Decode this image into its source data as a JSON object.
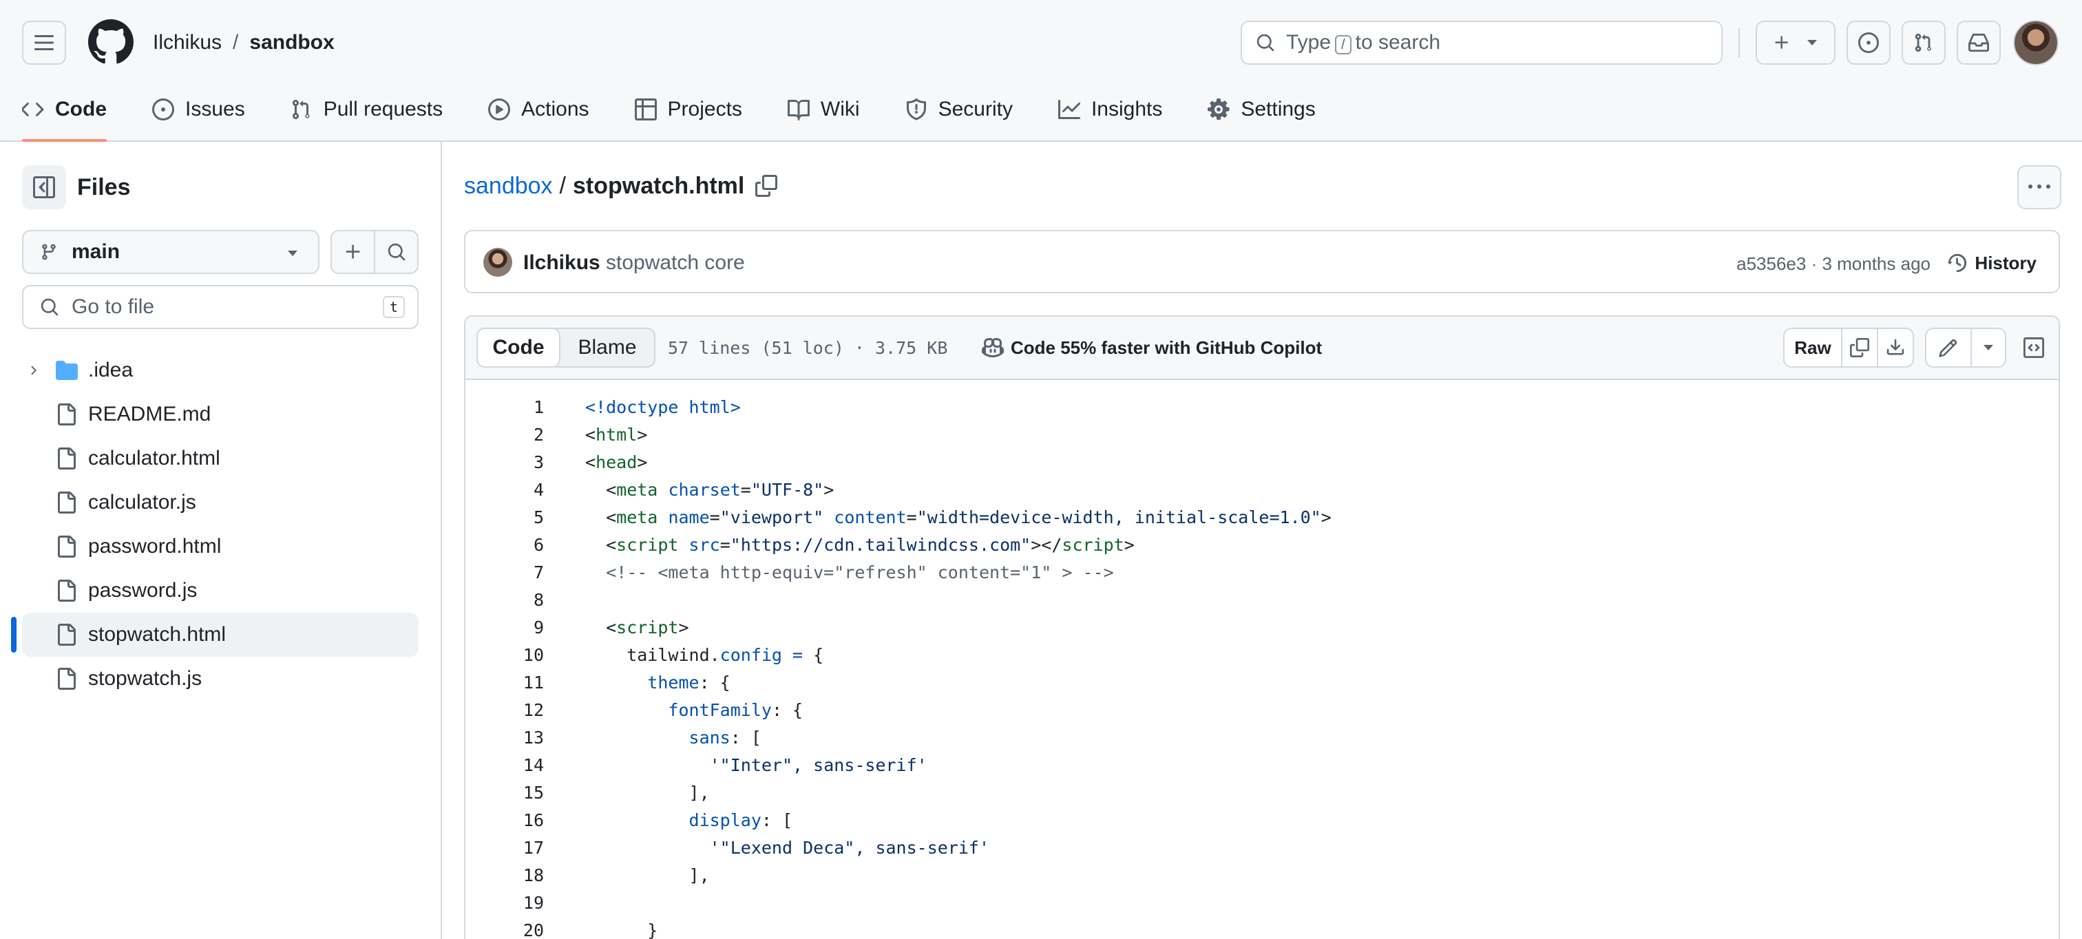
{
  "header": {
    "owner": "Ilchikus",
    "separator": "/",
    "repo": "sandbox",
    "search_prefix": "Type",
    "search_key": "/",
    "search_suffix": "to search"
  },
  "tabs": [
    {
      "label": "Code",
      "icon": "code-icon",
      "active": true
    },
    {
      "label": "Issues",
      "icon": "issue-opened-icon"
    },
    {
      "label": "Pull requests",
      "icon": "git-pull-request-icon"
    },
    {
      "label": "Actions",
      "icon": "play-icon"
    },
    {
      "label": "Projects",
      "icon": "table-icon"
    },
    {
      "label": "Wiki",
      "icon": "book-icon"
    },
    {
      "label": "Security",
      "icon": "shield-icon"
    },
    {
      "label": "Insights",
      "icon": "graph-icon"
    },
    {
      "label": "Settings",
      "icon": "gear-icon"
    }
  ],
  "sidebar": {
    "title": "Files",
    "branch": "main",
    "goto_placeholder": "Go to file",
    "goto_key": "t",
    "items": [
      {
        "label": ".idea",
        "type": "folder"
      },
      {
        "label": "README.md",
        "type": "file"
      },
      {
        "label": "calculator.html",
        "type": "file"
      },
      {
        "label": "calculator.js",
        "type": "file"
      },
      {
        "label": "password.html",
        "type": "file"
      },
      {
        "label": "password.js",
        "type": "file"
      },
      {
        "label": "stopwatch.html",
        "type": "file",
        "selected": true
      },
      {
        "label": "stopwatch.js",
        "type": "file"
      }
    ]
  },
  "file": {
    "repo_link": "sandbox",
    "separator": "/",
    "name": "stopwatch.html"
  },
  "commit": {
    "author": "Ilchikus",
    "message": "stopwatch core",
    "meta": "a5356e3 · 3 months ago",
    "history_label": "History"
  },
  "code_toolbar": {
    "code_tab": "Code",
    "blame_tab": "Blame",
    "stats": "57 lines (51 loc) · 3.75 KB",
    "copilot": "Code 55% faster with GitHub Copilot",
    "raw_label": "Raw"
  },
  "code": [
    {
      "n": "1",
      "t": [
        [
          "kw",
          "<!doctype html>"
        ]
      ]
    },
    {
      "n": "2",
      "t": [
        [
          "",
          "<"
        ],
        [
          "tag",
          "html"
        ],
        [
          "",
          ">"
        ]
      ]
    },
    {
      "n": "3",
      "t": [
        [
          "",
          "<"
        ],
        [
          "tag",
          "head"
        ],
        [
          "",
          ">"
        ]
      ]
    },
    {
      "n": "4",
      "t": [
        [
          "",
          "  <"
        ],
        [
          "tag",
          "meta"
        ],
        [
          "",
          " "
        ],
        [
          "kw",
          "charset"
        ],
        [
          "",
          "="
        ],
        [
          "str",
          "\"UTF-8\""
        ],
        [
          "",
          ">"
        ]
      ]
    },
    {
      "n": "5",
      "t": [
        [
          "",
          "  <"
        ],
        [
          "tag",
          "meta"
        ],
        [
          "",
          " "
        ],
        [
          "kw",
          "name"
        ],
        [
          "",
          "="
        ],
        [
          "str",
          "\"viewport\""
        ],
        [
          "",
          " "
        ],
        [
          "kw",
          "content"
        ],
        [
          "",
          "="
        ],
        [
          "str",
          "\"width=device-width, initial-scale=1.0\""
        ],
        [
          "",
          ">"
        ]
      ]
    },
    {
      "n": "6",
      "t": [
        [
          "",
          "  <"
        ],
        [
          "tag",
          "script"
        ],
        [
          "",
          " "
        ],
        [
          "kw",
          "src"
        ],
        [
          "",
          "="
        ],
        [
          "str",
          "\"https://cdn.tailwindcss.com\""
        ],
        [
          "",
          "></"
        ],
        [
          "tag",
          "script"
        ],
        [
          "",
          ">"
        ]
      ]
    },
    {
      "n": "7",
      "t": [
        [
          "cmt",
          "  <!-- <meta http-equiv=\"refresh\" content=\"1\" > -->"
        ]
      ]
    },
    {
      "n": "8",
      "t": [
        [
          "",
          ""
        ]
      ]
    },
    {
      "n": "9",
      "t": [
        [
          "",
          "  <"
        ],
        [
          "tag",
          "script"
        ],
        [
          "",
          ">"
        ]
      ]
    },
    {
      "n": "10",
      "t": [
        [
          "",
          "    tailwind."
        ],
        [
          "prop",
          "config"
        ],
        [
          "",
          " "
        ],
        [
          "kw",
          "="
        ],
        [
          "",
          " {"
        ]
      ]
    },
    {
      "n": "11",
      "t": [
        [
          "",
          "      "
        ],
        [
          "prop",
          "theme"
        ],
        [
          "",
          ": {"
        ]
      ]
    },
    {
      "n": "12",
      "t": [
        [
          "",
          "        "
        ],
        [
          "prop",
          "fontFamily"
        ],
        [
          "",
          ": {"
        ]
      ]
    },
    {
      "n": "13",
      "t": [
        [
          "",
          "          "
        ],
        [
          "prop",
          "sans"
        ],
        [
          "",
          ": ["
        ]
      ]
    },
    {
      "n": "14",
      "t": [
        [
          "",
          "            "
        ],
        [
          "str",
          "'\"Inter\", sans-serif'"
        ]
      ]
    },
    {
      "n": "15",
      "t": [
        [
          "",
          "          ],"
        ]
      ]
    },
    {
      "n": "16",
      "t": [
        [
          "",
          "          "
        ],
        [
          "prop",
          "display"
        ],
        [
          "",
          ": ["
        ]
      ]
    },
    {
      "n": "17",
      "t": [
        [
          "",
          "            "
        ],
        [
          "str",
          "'\"Lexend Deca\", sans-serif'"
        ]
      ]
    },
    {
      "n": "18",
      "t": [
        [
          "",
          "          ],"
        ]
      ]
    },
    {
      "n": "19",
      "t": [
        [
          "",
          ""
        ]
      ]
    },
    {
      "n": "20",
      "t": [
        [
          "",
          "      }"
        ]
      ]
    }
  ]
}
